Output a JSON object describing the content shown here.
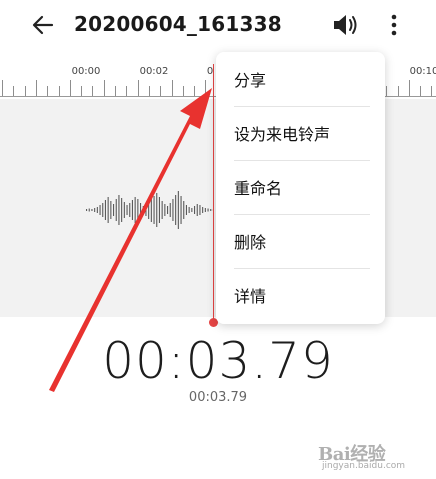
{
  "app": {
    "title": "20200604_161338",
    "icons": {
      "back": "arrow-left-icon",
      "speaker": "speaker-volume-icon",
      "more": "more-vertical-icon"
    }
  },
  "ruler": {
    "labels": [
      "00:00",
      "00:02",
      "0",
      "00:10"
    ]
  },
  "menu": {
    "items": [
      {
        "label": "分享"
      },
      {
        "label": "设为来电铃声"
      },
      {
        "label": "重命名"
      },
      {
        "label": "删除"
      },
      {
        "label": "详情"
      }
    ]
  },
  "playback": {
    "elapsed": "00:03.79",
    "elapsed_small": "00:03.79"
  },
  "colors": {
    "playhead": "#e64545",
    "annotation_arrow": "#e8322f"
  },
  "watermark": {
    "logo_text": "Bai经验",
    "url": "jingyan.baidu.com"
  }
}
